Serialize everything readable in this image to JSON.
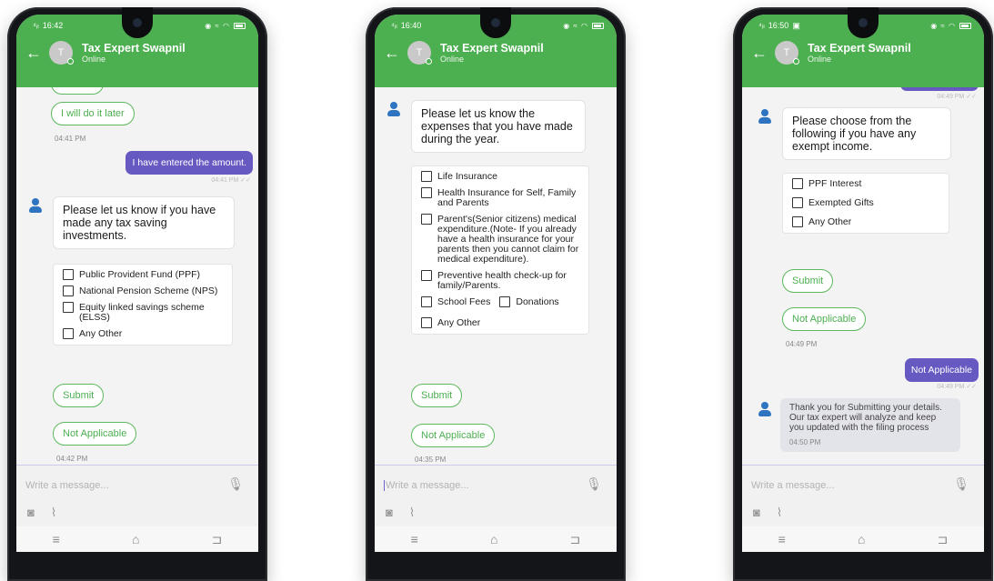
{
  "phones": [
    {
      "status_time": "16:42",
      "contact_name": "Tax Expert Swapnil",
      "contact_status": "Online",
      "avatar_letter": "T",
      "top_pill": "I will do it later",
      "time1": "04:41 PM",
      "sent_msg": "I have entered the amount.",
      "sent_time": "04:41 PM",
      "bot_question": "Please let us know if you have made any tax saving investments.",
      "options": [
        "Public Provident Fund (PPF)",
        "National Pension Scheme (NPS)",
        "Equity linked savings scheme (ELSS)",
        "Any Other"
      ],
      "submit": "Submit",
      "not_applicable": "Not Applicable",
      "time2": "04:42 PM",
      "input_placeholder": "Write a message..."
    },
    {
      "status_time": "16:40",
      "contact_name": "Tax Expert Swapnil",
      "contact_status": "Online",
      "avatar_letter": "T",
      "bot_question": "Please let us know the expenses that you have made during the year.",
      "options": [
        "Life Insurance",
        "Health Insurance for Self, Family and Parents",
        "Parent's(Senior citizens) medical expenditure.(Note- If you already have a health insurance for your parents then you cannot claim for medical expenditure).",
        "Preventive health check-up for family/Parents.",
        "School Fees",
        "Donations",
        "Any Other"
      ],
      "submit": "Submit",
      "not_applicable": "Not Applicable",
      "time": "04:35 PM",
      "input_placeholder": "Write a message..."
    },
    {
      "status_time": "16:50",
      "contact_name": "Tax Expert Swapnil",
      "contact_status": "Online",
      "avatar_letter": "T",
      "sent_time_top": "04:49 PM",
      "bot_question": "Please choose from the following if you have any exempt income.",
      "options": [
        "PPF Interest",
        "Exempted Gifts",
        "Any Other"
      ],
      "submit": "Submit",
      "not_applicable": "Not Applicable",
      "time1": "04:49 PM",
      "sent_msg": "Not Applicable",
      "sent_time": "04:49 PM",
      "thanks_msg": "Thank you for Submitting your details. Our tax expert will analyze and keep you updated with the filing process",
      "thanks_time": "04:50 PM",
      "input_placeholder": "Write a message..."
    }
  ],
  "icons": [
    "back-arrow-icon",
    "mic-icon",
    "camera-icon",
    "paperclip-icon",
    "menu-icon",
    "home-icon",
    "back-nav-icon",
    "bot-avatar-icon"
  ],
  "colors": {
    "header_green": "#4caf50",
    "sent_purple": "#6659c2",
    "pill_border": "#5cb85c",
    "bot_blue": "#2f74c0"
  }
}
